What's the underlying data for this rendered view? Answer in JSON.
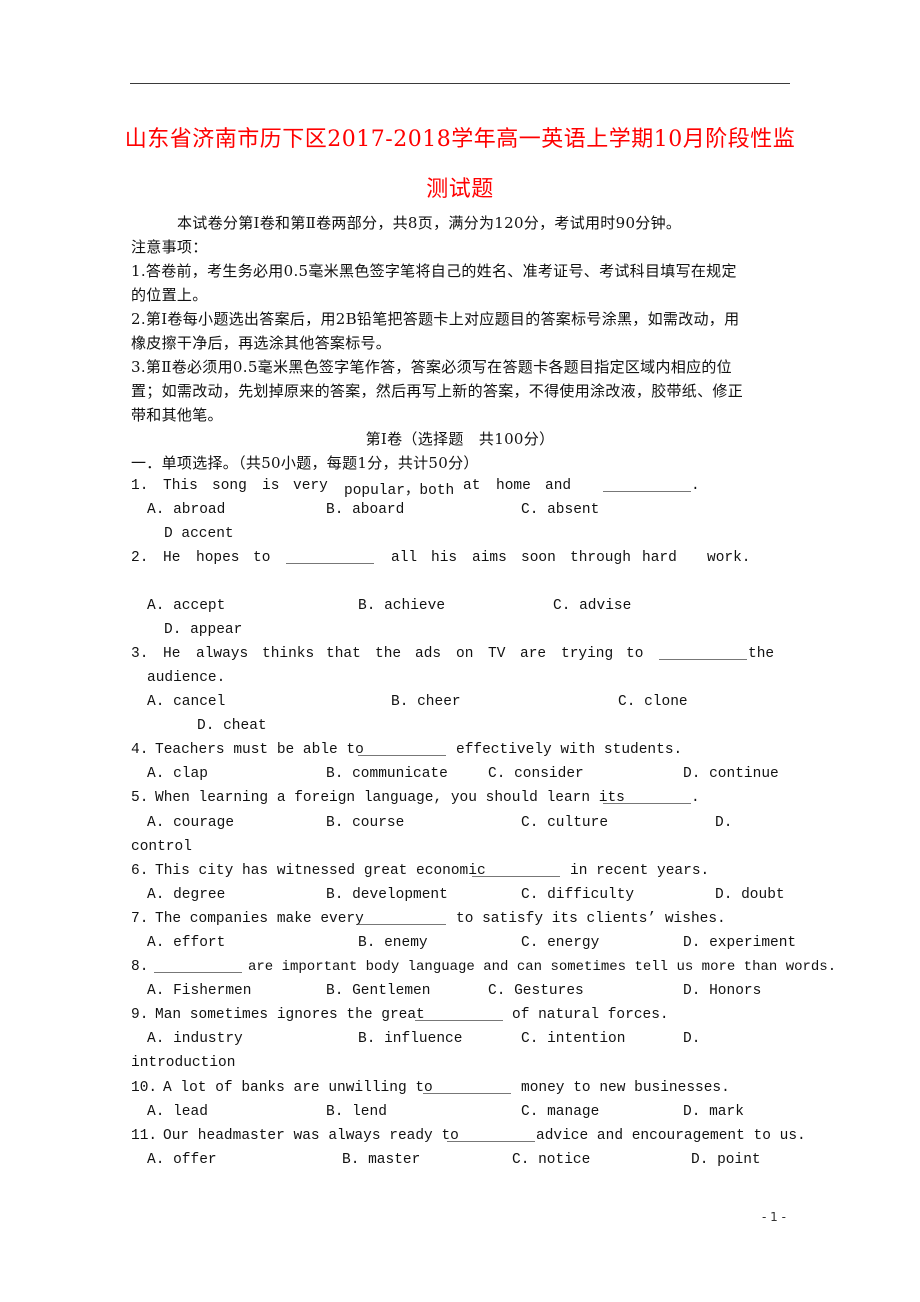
{
  "document": {
    "title_line1": "山东省济南市历下区2017-2018学年高一英语上学期10月阶段性监",
    "title_line2": "测试题",
    "intro": "本试卷分第Ⅰ卷和第Ⅱ卷两部分，共8页，满分为120分，考试用时90分钟。",
    "notice_heading": "注意事项：",
    "notice_items": [
      {
        "line1": "1.答卷前，考生务必用0.5毫米黑色签字笔将自己的姓名、准考证号、考试科目填写在规定",
        "line2": "的位置上。"
      },
      {
        "line1": "2.第Ⅰ卷每小题选出答案后，用2B铅笔把答题卡上对应题目的答案标号涂黑，如需改动，用",
        "line2": "橡皮擦干净后，再选涂其他答案标号。"
      },
      {
        "line1": "3.第Ⅱ卷必须用0.5毫米黑色签字笔作答，答案必须写在答题卡各题目指定区域内相应的位",
        "line2": "置；如需改动，先划掉原来的答案，然后再写上新的答案，不得使用涂改液，胶带纸、修正",
        "line3": "带和其他笔。"
      }
    ],
    "part_heading": "第Ⅰ卷（选择题　共100分）",
    "section_heading": "一．单项选择。（共50小题，每题1分，共计50分）",
    "questions": [
      {
        "num": "1.",
        "stem": [
          "This",
          "song",
          "is",
          "very",
          "popular，both",
          "at",
          "home",
          "and"
        ],
        "after": ".",
        "options": [
          "A. abroad",
          "B.  aboard",
          "C.  absent",
          "D  accent"
        ]
      },
      {
        "num": "2.",
        "stem_before": [
          "He",
          "hopes",
          "to"
        ],
        "stem_after": [
          "all",
          "his",
          "aims",
          "soon",
          "through",
          "hard",
          "work."
        ],
        "options": [
          "A.  accept",
          "B.  achieve",
          "C.  advise",
          "D.  appear"
        ]
      },
      {
        "num": "3.",
        "stem_before": [
          "He",
          "always",
          "thinks",
          "that",
          "the",
          "ads",
          "on",
          "TV",
          "are",
          "trying",
          "to"
        ],
        "stem_after": "the",
        "continuation": "audience.",
        "options": [
          "A.  cancel",
          "B.  cheer",
          "C.  clone",
          "D.  cheat"
        ]
      },
      {
        "num": "4.",
        "stem_before": "Teachers must be able to",
        "stem_after": "effectively with students.",
        "options": [
          "A. clap",
          "B. communicate",
          "C. consider",
          "D. continue"
        ]
      },
      {
        "num": "5.",
        "stem_before": "When learning a foreign language, you should learn its",
        "stem_after": ".",
        "options": [
          "A. courage",
          "B. course",
          "C. culture",
          "D."
        ],
        "wrap_option": "control"
      },
      {
        "num": "6.",
        "stem_before": "This city has witnessed great economic",
        "stem_after": "in recent years.",
        "options": [
          "A. degree",
          "B. development",
          "C. difficulty",
          "D. doubt"
        ]
      },
      {
        "num": "7.",
        "stem_before": "The companies make every",
        "stem_after": "to satisfy its clients’ wishes.",
        "options": [
          "A. effort",
          "B. enemy",
          "C. energy",
          "D. experiment"
        ]
      },
      {
        "num": "8.",
        "stem_before": "",
        "stem_after": "are important body language and can sometimes tell us more than words.",
        "options": [
          "A. Fishermen",
          "B. Gentlemen",
          "C. Gestures",
          "D. Honors"
        ]
      },
      {
        "num": "9.",
        "stem_before": "Man sometimes ignores the great",
        "stem_after": "of natural forces.",
        "options": [
          "A. industry",
          "B. influence",
          "C. intention",
          "D."
        ],
        "wrap_option": "introduction"
      },
      {
        "num": "10.",
        "stem_before": "A lot of banks are unwilling to",
        "stem_after": "money to new businesses.",
        "options": [
          "A. lead",
          "B. lend",
          "C. manage",
          "D. mark"
        ]
      },
      {
        "num": "11.",
        "stem_before": "Our headmaster was always ready to",
        "stem_after": "advice and encouragement to us.",
        "options": [
          "A. offer",
          "B. master",
          "C. notice",
          "D. point"
        ]
      }
    ],
    "page_number": "- 1 -"
  }
}
